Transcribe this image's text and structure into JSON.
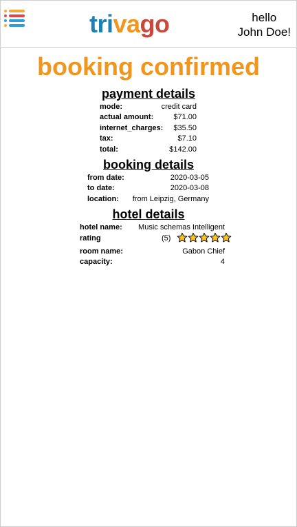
{
  "brand": {
    "parts": [
      "tri",
      "va",
      "go"
    ],
    "colors": [
      "#1d7fb2",
      "#f0961e",
      "#c8493b"
    ]
  },
  "menu": {
    "icon": "list-menu-icon",
    "dot_colors": [
      "#f2a93b",
      "#e0474c",
      "#2e9fd8",
      "#f2a93b"
    ]
  },
  "user": {
    "greeting": "hello",
    "name": "John Doe!"
  },
  "page_title": "booking confirmed",
  "accent_color": "#f0961e",
  "payment": {
    "heading": "payment details",
    "rows": [
      {
        "label": "mode:",
        "value": "credit card"
      },
      {
        "label": "actual amount:",
        "value": "$71.00"
      },
      {
        "label": "internet_charges:",
        "value": "$35.50"
      },
      {
        "label": "tax:",
        "value": "$7.10"
      },
      {
        "label": "total:",
        "value": "$142.00"
      }
    ]
  },
  "booking": {
    "heading": "booking details",
    "rows": [
      {
        "label": "from date:",
        "value": "2020-03-05"
      },
      {
        "label": "to date:",
        "value": "2020-03-08"
      },
      {
        "label": "location:",
        "value": "from Leipzig, Germany"
      }
    ]
  },
  "hotel": {
    "heading": "hotel details",
    "name_label": "hotel name:",
    "name_value": "Music schemas Intelligent",
    "rating_label": "rating",
    "rating_value": "(5)",
    "rating_stars": 5,
    "star_color": "#f7c31e",
    "room_label": "room name:",
    "room_value": "Gabon Chief",
    "capacity_label": "capacity:",
    "capacity_value": "4"
  }
}
